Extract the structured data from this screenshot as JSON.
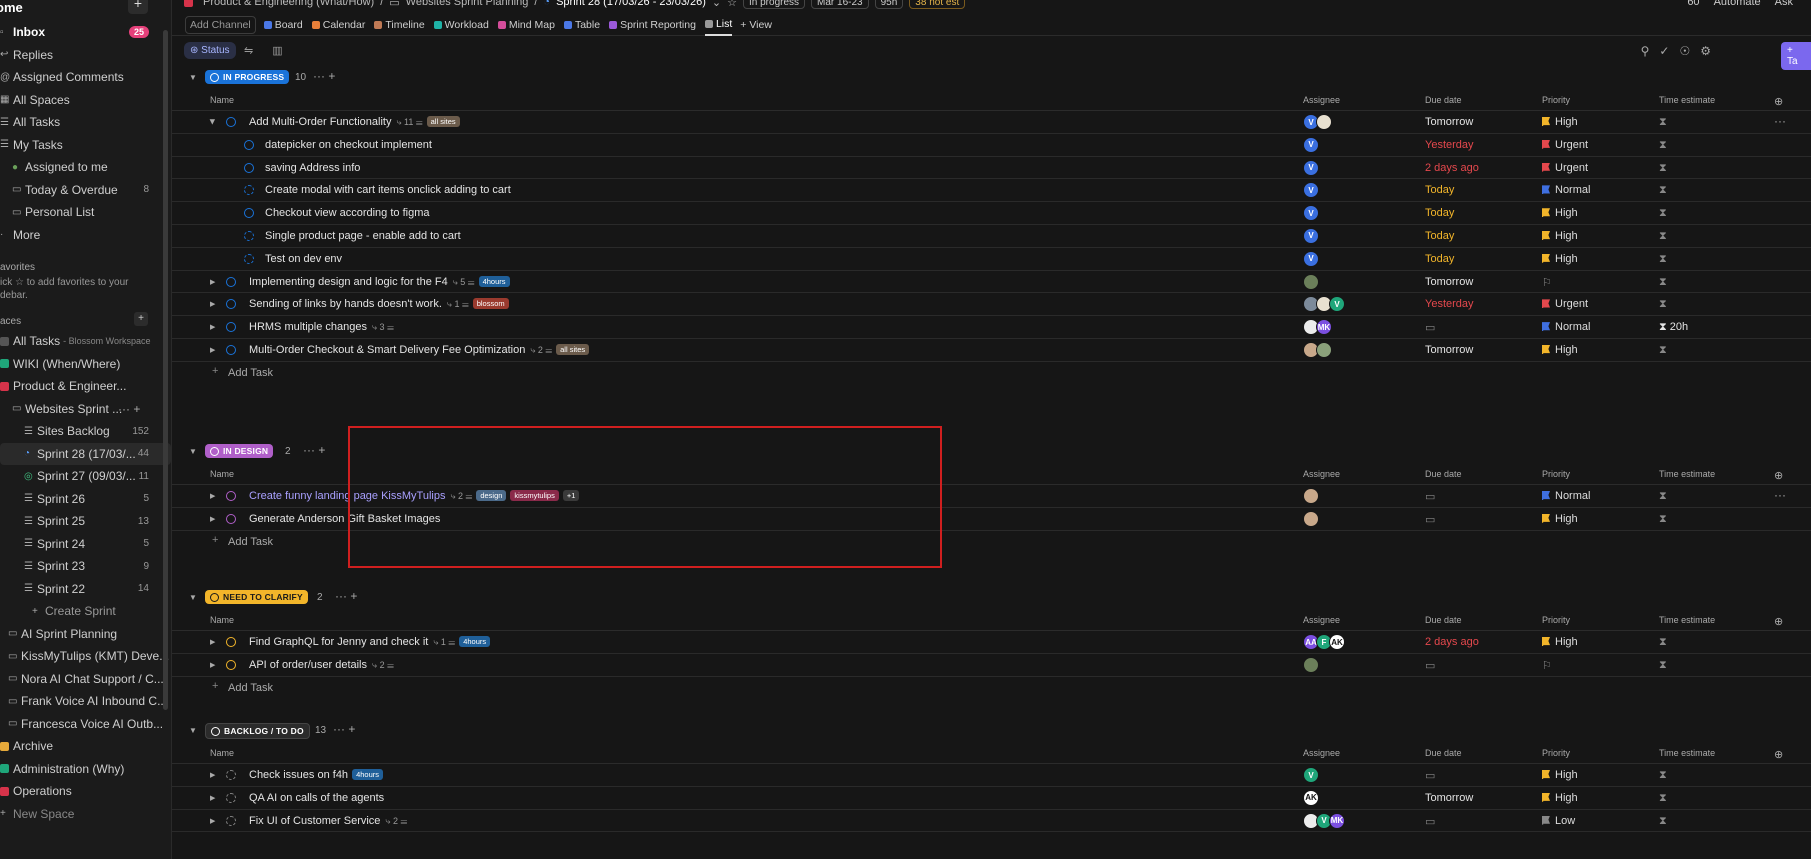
{
  "sidebar": {
    "home": "ome",
    "inbox": {
      "label": "Inbox",
      "badge": "25"
    },
    "items": [
      "Replies",
      "Assigned Comments",
      "All Spaces",
      "All Tasks",
      "My Tasks"
    ],
    "sub_items": [
      {
        "label": "Assigned to me",
        "count": ""
      },
      {
        "label": "Today & Overdue",
        "count": "8"
      },
      {
        "label": "Personal List",
        "count": ""
      }
    ],
    "more": "More",
    "favorites": "avorites",
    "favorites_hint": "ick ☆ to add favorites to your debar.",
    "spaces": "aces",
    "spaces_list": [
      {
        "label": "All Tasks",
        "meta": "- Blossom Workspace"
      },
      {
        "label": "WIKI (When/Where)",
        "meta": ""
      },
      {
        "label": "Product & Engineer...",
        "meta": ""
      }
    ],
    "folder": "Websites Sprint ...",
    "sprints": [
      {
        "label": "Sites Backlog",
        "count": "152"
      },
      {
        "label": "Sprint 28 (17/03/...",
        "count": "44"
      },
      {
        "label": "Sprint 27 (09/03/...",
        "count": "11"
      },
      {
        "label": "Sprint 26",
        "count": "5"
      },
      {
        "label": "Sprint 25",
        "count": "13"
      },
      {
        "label": "Sprint 24",
        "count": "5"
      },
      {
        "label": "Sprint 23",
        "count": "9"
      },
      {
        "label": "Sprint 22",
        "count": "14"
      }
    ],
    "create_sprint": "Create Sprint",
    "lists": [
      "AI Sprint Planning",
      "KissMyTulips (KMT) Deve...",
      "Nora AI Chat Support / C...",
      "Frank Voice AI Inbound C...",
      "Francesca Voice AI Outb..."
    ],
    "bottom": [
      "Archive",
      "Administration (Why)",
      "Operations"
    ],
    "new_space": "New Space"
  },
  "topbar": {
    "crumb1": "Product & Engineering (What/How)",
    "crumb2": "Websites Sprint Planning",
    "crumb3": "Sprint 28 (17/03/26 - 23/03/26)",
    "status": "In progress",
    "dates": "Mar 16-23",
    "hours": "95h",
    "not_est": "38 not est",
    "right": [
      "60",
      "Automate",
      "Ask"
    ]
  },
  "views": {
    "add_channel": "Add Channel",
    "tabs": [
      {
        "label": "Board",
        "color": "#4b78e6"
      },
      {
        "label": "Calendar",
        "color": "#e8803a"
      },
      {
        "label": "Timeline",
        "color": "#c07a55"
      },
      {
        "label": "Workload",
        "color": "#1fb2a6"
      },
      {
        "label": "Mind Map",
        "color": "#d44d9a"
      },
      {
        "label": "Table",
        "color": "#4b78e6"
      },
      {
        "label": "Sprint Reporting",
        "color": "#9b59d9"
      },
      {
        "label": "List",
        "color": "#999999"
      }
    ],
    "add_view": "+ View"
  },
  "filter": {
    "status": "Status",
    "task_btn": "Ta"
  },
  "columns": {
    "name": "Name",
    "assignee": "Assignee",
    "due": "Due date",
    "priority": "Priority",
    "estimate": "Time estimate"
  },
  "add_task": "Add Task",
  "groups": {
    "in_progress": {
      "label": "IN PROGRESS",
      "count": "10",
      "color": "#1a73d9",
      "rows": [
        {
          "title": "Add Multi-Order Functionality",
          "meta": "11",
          "tags": [
            {
              "t": "all sites",
              "c": "#6b5b4b"
            }
          ],
          "due": "Tomorrow",
          "priority": "High"
        },
        {
          "title": "datepicker on checkout implement",
          "meta": "",
          "tags": [],
          "due": "Yesterday",
          "priority": "Urgent"
        },
        {
          "title": "saving Address info",
          "meta": "",
          "tags": [],
          "due": "2 days ago",
          "priority": "Urgent"
        },
        {
          "title": "Create modal with cart items onclick adding to cart",
          "meta": "",
          "tags": [],
          "due": "Today",
          "priority": "Normal"
        },
        {
          "title": "Checkout view according to figma",
          "meta": "",
          "tags": [],
          "due": "Today",
          "priority": "High"
        },
        {
          "title": "Single product page - enable add to cart",
          "meta": "",
          "tags": [],
          "due": "Today",
          "priority": "High"
        },
        {
          "title": "Test on dev env",
          "meta": "",
          "tags": [],
          "due": "Today",
          "priority": "High"
        },
        {
          "title": "Implementing design and logic for the F4",
          "meta": "5",
          "tags": [
            {
              "t": "4hours",
              "c": "#1f5f99"
            }
          ],
          "due": "Tomorrow",
          "priority": ""
        },
        {
          "title": "Sending of links by hands doesn't work.",
          "meta": "1",
          "tags": [
            {
              "t": "blossom",
              "c": "#9a3a2e"
            }
          ],
          "due": "Yesterday",
          "priority": "Urgent"
        },
        {
          "title": "HRMS multiple changes",
          "meta": "3",
          "tags": [],
          "due": "",
          "priority": "Normal",
          "estimate": "20h"
        },
        {
          "title": "Multi-Order Checkout & Smart Delivery Fee Optimization",
          "meta": "2",
          "tags": [
            {
              "t": "all sites",
              "c": "#6b5b4b"
            }
          ],
          "due": "Tomorrow",
          "priority": "High"
        }
      ]
    },
    "in_design": {
      "label": "IN DESIGN",
      "count": "2",
      "color": "#b05fc9",
      "rows": [
        {
          "title": "Create funny landing page KissMyTulips",
          "meta": "2",
          "tags": [
            {
              "t": "design",
              "c": "#4b6a8a"
            },
            {
              "t": "kissmytulips",
              "c": "#8a2a4a"
            },
            {
              "t": "+1",
              "c": "#3a3a3a"
            }
          ],
          "due": "",
          "priority": "Normal"
        },
        {
          "title": "Generate Anderson Gift Basket Images",
          "meta": "",
          "tags": [],
          "due": "",
          "priority": "High"
        }
      ]
    },
    "need_clarify": {
      "label": "NEED TO CLARIFY",
      "count": "2",
      "color": "#f2b52a",
      "rows": [
        {
          "title": "Find GraphQL for Jenny and check it",
          "meta": "1",
          "tags": [
            {
              "t": "4hours",
              "c": "#1f5f99"
            }
          ],
          "due": "2 days ago",
          "priority": "High"
        },
        {
          "title": "API of order/user details",
          "meta": "2",
          "tags": [],
          "due": "",
          "priority": ""
        }
      ]
    },
    "backlog": {
      "label": "BACKLOG / TO DO",
      "count": "13",
      "color": "#3a3a3a",
      "rows": [
        {
          "title": "Check issues on f4h",
          "meta": "",
          "tags": [
            {
              "t": "4hours",
              "c": "#1f5f99"
            }
          ],
          "due": "",
          "priority": "High"
        },
        {
          "title": "QA AI on calls of the agents",
          "meta": "",
          "tags": [],
          "due": "Tomorrow",
          "priority": "High"
        },
        {
          "title": "Fix UI of Customer Service",
          "meta": "2",
          "tags": [],
          "due": "",
          "priority": "Low"
        }
      ]
    }
  }
}
